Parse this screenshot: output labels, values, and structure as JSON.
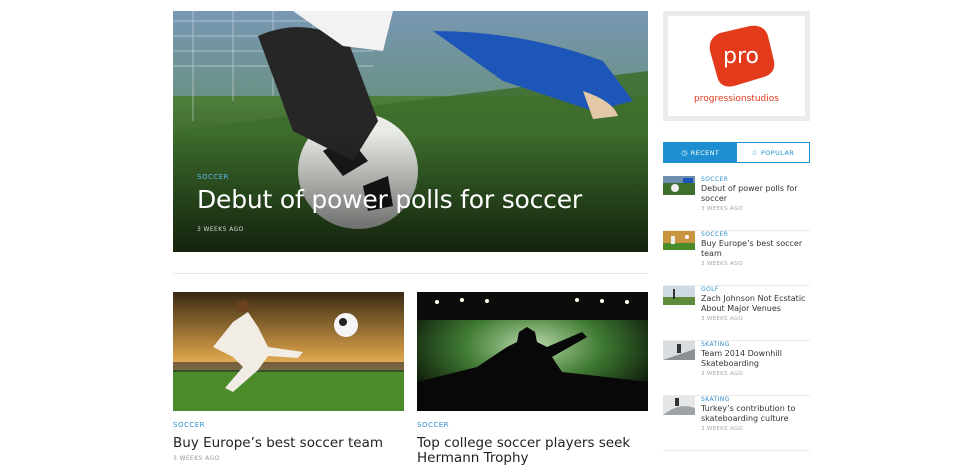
{
  "hero": {
    "category": "SOCCER",
    "title": "Debut of power polls for soccer",
    "date": "3 WEEKS AGO"
  },
  "cards": [
    {
      "category": "SOCCER",
      "title": "Buy Europe’s best soccer team",
      "date": "3 WEEKS AGO"
    },
    {
      "category": "SOCCER",
      "title": "Top college soccer players seek Hermann Trophy",
      "date": ""
    }
  ],
  "sidebar": {
    "logo_mark": "pro",
    "logo_text": "progressionstudios",
    "tabs": {
      "recent": "RECENT",
      "popular": "POPULAR"
    },
    "items": [
      {
        "category": "SOCCER",
        "title": "Debut of power polls for soccer",
        "date": "3 WEEKS AGO"
      },
      {
        "category": "SOCCER",
        "title": "Buy Europe’s best soccer team",
        "date": "3 WEEKS AGO"
      },
      {
        "category": "GOLF",
        "title": "Zach Johnson Not Ecstatic About Major Venues",
        "date": "3 WEEKS AGO"
      },
      {
        "category": "SKATING",
        "title": "Team 2014 Downhill Skateboarding",
        "date": "3 WEEKS AGO"
      },
      {
        "category": "SKATING",
        "title": "Turkey’s contribution to skateboarding culture",
        "date": "3 WEEKS AGO"
      }
    ]
  },
  "colors": {
    "accent": "#1d8fd0",
    "category": "#2f8fc9",
    "brand": "#e43a1c"
  }
}
